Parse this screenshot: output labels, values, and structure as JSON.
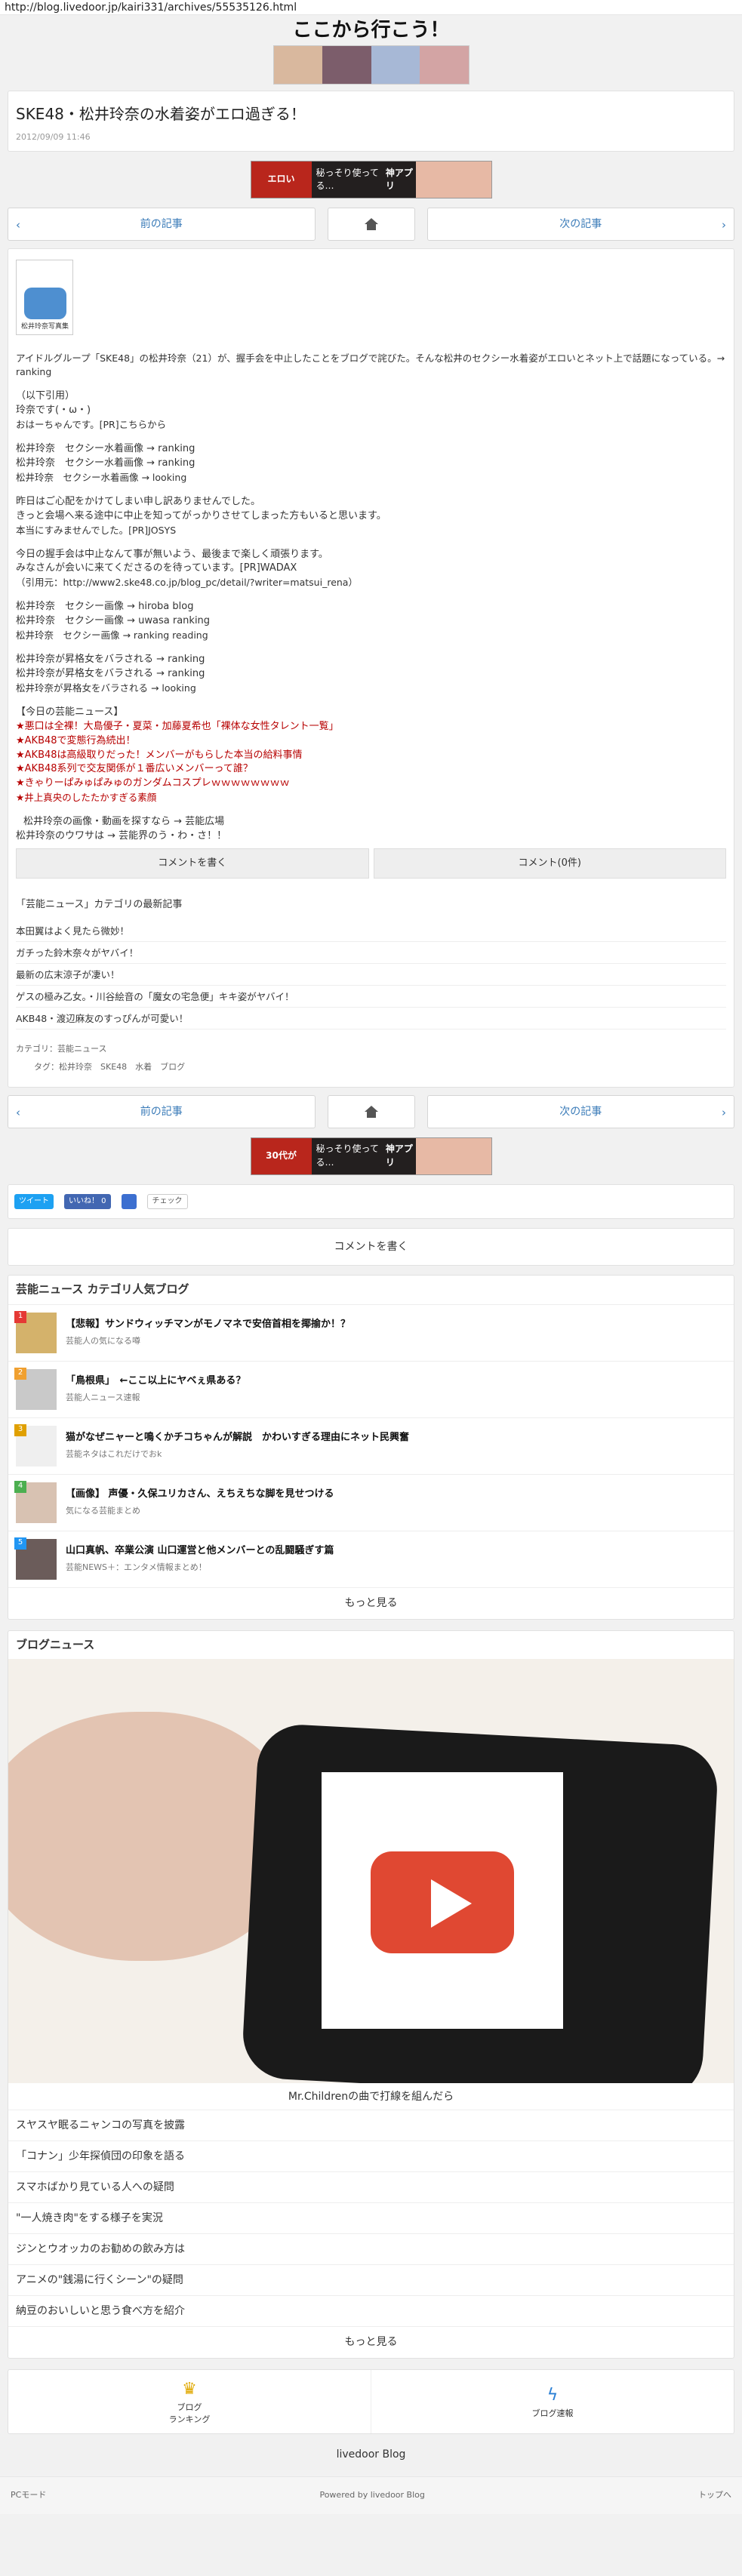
{
  "url": "http://blog.livedoor.jp/kairi331/archives/55535126.html",
  "blog_title": "ここから行こう！",
  "article": {
    "title": "SKE48・松井玲奈の水着姿がエロ過ぎる！",
    "date": "2012/09/09 11:46"
  },
  "ad": {
    "line1": "エロい",
    "line2": "30代が",
    "line3": "秘っそり使ってる…",
    "line4": "神アプリ"
  },
  "nav": {
    "prev": "前の記事",
    "next": "次の記事"
  },
  "thumb_text": "松井玲奈写真集",
  "body": {
    "intro": "アイドルグループ「SKE48」の松井玲奈（21）が、握手会を中止したことをブログで詫びた。そんな松井のセクシー水着姿がエロいとネット上で話題になっている。→ ranking",
    "quote": "（以下引用）",
    "quote2": "玲奈です(・ω・)",
    "quote3": "おはーちゃんです。[PR]こちらから",
    "s1": "松井玲奈　セクシー水着画像 → ranking",
    "s2": "松井玲奈　セクシー水着画像 → ranking",
    "s3": "松井玲奈　セクシー水着画像 → looking",
    "p1": "昨日はご心配をかけてしまい申し訳ありませんでした。",
    "p2": "きっと会場へ来る途中に中止を知ってがっかりさせてしまった方もいると思います。",
    "p3": "本当にすみませんでした。[PR]JOSYS",
    "p4": "今日の握手会は中止なんて事が無いよう、最後まで楽しく頑張ります。",
    "p5": "みなさんが会いに来てくださるのを待っています。[PR]WADAX",
    "p6": "（引用元：http://www2.ske48.co.jp/blog_pc/detail/?writer=matsui_rena）",
    "s4": "松井玲奈　セクシー画像 → hiroba blog",
    "s5": "松井玲奈　セクシー画像 → uwasa ranking",
    "s6": "松井玲奈　セクシー画像 → ranking reading",
    "s7": "松井玲奈が昇格女をバラされる → ranking",
    "s8": "松井玲奈が昇格女をバラされる → ranking",
    "s9": "松井玲奈が昇格女をバラされる → looking",
    "news_head": "【今日の芸能ニュース】",
    "news1": "★悪口は全裸！大島優子・夏菜・加藤夏希也「裸体な女性タレント一覧」",
    "news2": "★AKB48で変態行為続出！",
    "news3": "★AKB48は高級取りだった！メンバーがもらした本当の給料事情",
    "news4": "★AKB48系列で交友関係が１番広いメンバーって誰？",
    "news5": "★きゃりーぱみゅぱみゅのガンダムコスプレｗｗｗｗｗｗｗｗ",
    "news6": "★井上真央のしたたかすぎる素顔",
    "e1": "松井玲奈の画像・動画を探すなら → 芸能広場",
    "e2": "松井玲奈のウワサは → 芸能界のう・わ・さ！！"
  },
  "comment_btns": {
    "write": "コメントを書く",
    "count": "コメント(0件)"
  },
  "category": {
    "heading": "「芸能ニュース」カテゴリの最新記事",
    "items": [
      "本田翼はよく見たら微妙！",
      "ガチった鈴木奈々がヤバイ！",
      "最新の広末涼子が凄い！",
      "ゲスの極み乙女。・川谷絵音の「魔女の宅急便」キキ姿がヤバイ！",
      "AKB48・渡辺麻友のすっぴんが可愛い！"
    ]
  },
  "meta": {
    "cat": "カテゴリ：芸能ニュース",
    "tags": "タグ：松井玲奈　SKE48　水着　ブログ"
  },
  "social": {
    "tweet": "ツイート",
    "like": "いいね！ 0",
    "check": "チェック"
  },
  "comment_wide": "コメントを書く",
  "ranking": {
    "heading": "芸能ニュース カテゴリ人気ブログ",
    "items": [
      {
        "rank": "1",
        "title": "【悲報】サンドウィッチマンがモノマネで安倍首相を揶揄か！？",
        "sub": "芸能人の気になる噂"
      },
      {
        "rank": "2",
        "title": "「鳥根県」　←ここ以上にヤベぇ県ある？",
        "sub": "芸能人ニュース速報"
      },
      {
        "rank": "3",
        "title": "猫がなぜニャーと鳴くかチコちゃんが解説　かわいすぎる理由にネット民興奮",
        "sub": "芸能ネタはこれだけでおk"
      },
      {
        "rank": "4",
        "title": "【画像】 声優・久保ユリカさん、えちえちな脚を見せつける",
        "sub": "気になる芸能まとめ"
      },
      {
        "rank": "5",
        "title": "山口真帆、卒業公演 山口運営と他メンバーとの乱闘騒ぎす篇",
        "sub": "芸能NEWS＋：エンタメ情報まとめ！"
      }
    ],
    "more": "もっと見る"
  },
  "blognews": {
    "heading": "ブログニュース",
    "caption": "Mr.Childrenの曲で打線を組んだら",
    "items": [
      "スヤスヤ眠るニャンコの写真を披露",
      "「コナン」少年探偵団の印象を語る",
      "スマホばかり見ている人への疑問",
      "\"一人焼き肉\"をする様子を実況",
      "ジンとウオッカのお勧めの飲み方は",
      "アニメの\"銭湯に行くシーン\"の疑問",
      "納豆のおいしいと思う食べ方を紹介"
    ],
    "more": "もっと見る"
  },
  "footer_nav": {
    "ranking": "ブログ\nランキング",
    "news": "ブログ速報"
  },
  "logo": "livedoor Blog",
  "bottom": {
    "left": "PCモード",
    "center": "Powered by livedoor Blog",
    "right": "トップへ"
  },
  "colors": {
    "link": "#1a0dab",
    "nav_text": "#3a7bb8",
    "ad_red": "#b9261c"
  }
}
